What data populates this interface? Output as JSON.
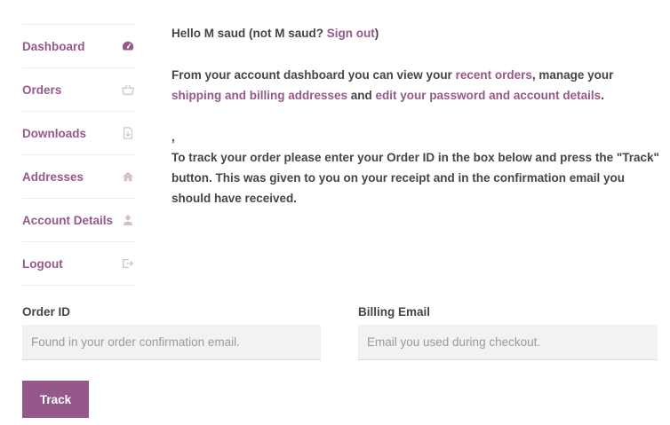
{
  "sidebar": {
    "items": [
      {
        "label": "Dashboard",
        "icon": "dashboard-icon"
      },
      {
        "label": "Orders",
        "icon": "basket-icon"
      },
      {
        "label": "Downloads",
        "icon": "file-download-icon"
      },
      {
        "label": "Addresses",
        "icon": "home-icon"
      },
      {
        "label": "Account Details",
        "icon": "user-icon"
      },
      {
        "label": "Logout",
        "icon": "sign-out-icon"
      }
    ]
  },
  "greeting": {
    "hello": "Hello M saud (not M saud? ",
    "sign_out": "Sign out",
    "close": ")"
  },
  "intro": {
    "t1": "From your account dashboard you can view your ",
    "recent_orders": "recent orders",
    "t2": ", manage your ",
    "shipping": "shipping and billing addresses",
    "t3": " and ",
    "account": "edit your password and account details",
    "t4": "."
  },
  "comma": ",",
  "track_text": "To track your order please enter your Order ID in the box below and press the \"Track\" button. This was given to you on your receipt and in the confirmation email you should have received.",
  "form": {
    "order_id_label": "Order ID",
    "order_id_placeholder": "Found in your order confirmation email.",
    "billing_email_label": "Billing Email",
    "billing_email_placeholder": "Email you used during checkout.",
    "track_button": "Track"
  },
  "colors": {
    "accent": "#96588a",
    "icon": "#d5c0d0",
    "text": "#43454b",
    "input_bg": "#f2f2f2"
  }
}
